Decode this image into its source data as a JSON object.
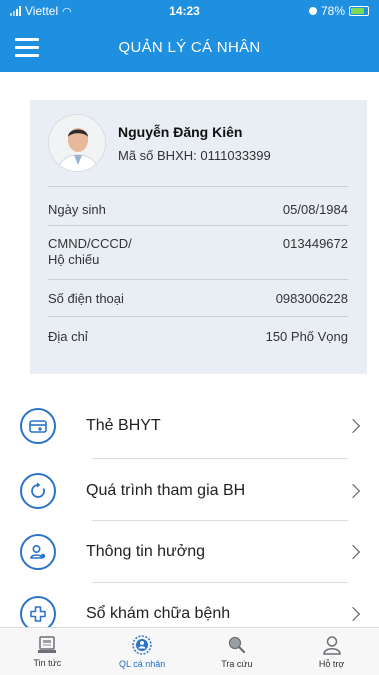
{
  "status_bar": {
    "carrier": "Viettel",
    "time": "14:23",
    "battery": "78%"
  },
  "header": {
    "title": "QUẢN LÝ CÁ NHÂN",
    "menu_icon": "hamburger-menu-icon"
  },
  "profile": {
    "name": "Nguyễn Đăng Kiên",
    "bhxh_label": "Mã số BHXH:",
    "bhxh_number": "0111033399",
    "fields": [
      {
        "label": "Ngày sinh",
        "value": "05/08/1984"
      },
      {
        "label_line1": "CMND/CCCD/",
        "label_line2": "Hộ chiếu",
        "value": "013449672"
      },
      {
        "label": "Số điện thoại",
        "value": "0983006228"
      },
      {
        "label": "Địa chỉ",
        "value": "150 Phố Vọng"
      }
    ]
  },
  "menu": {
    "items": [
      {
        "label": "Thẻ BHYT",
        "icon": "health-card-icon"
      },
      {
        "label": "Quá trình tham gia BH",
        "icon": "history-icon"
      },
      {
        "label": "Thông tin hưởng",
        "icon": "user-benefit-icon"
      },
      {
        "label": "Sổ khám chữa bệnh",
        "icon": "medical-cross-icon"
      }
    ]
  },
  "bottom_nav": {
    "items": [
      {
        "label": "Tin tức",
        "icon": "news-icon",
        "active": false
      },
      {
        "label": "QL cá nhân",
        "icon": "personal-management-icon",
        "active": true
      },
      {
        "label": "Tra cứu",
        "icon": "search-lookup-icon",
        "active": false
      },
      {
        "label": "Hỗ trợ",
        "icon": "support-user-icon",
        "active": false
      }
    ]
  },
  "colors": {
    "primary": "#1f8fe0",
    "icon_blue": "#2b73c8",
    "card_bg": "#e9eef4"
  }
}
